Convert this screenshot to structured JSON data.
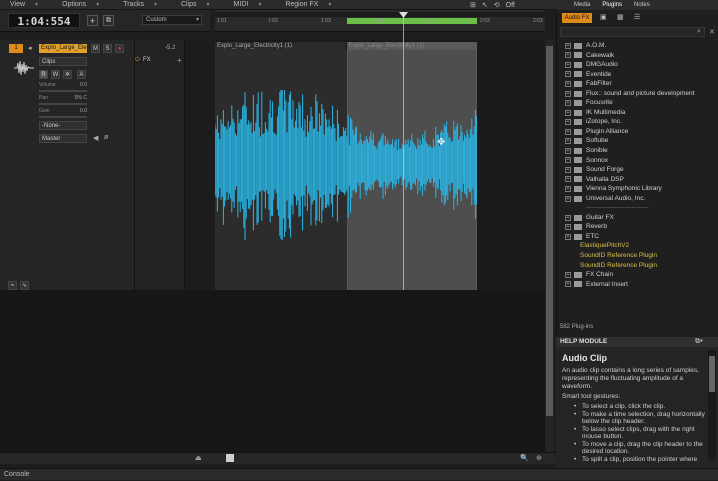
{
  "menu": {
    "items": [
      "View",
      "Options",
      "Tracks",
      "Clips",
      "MIDI",
      "Region FX"
    ],
    "off_label": "Off"
  },
  "control_bar": {
    "time": "1:04:554",
    "preset": "Custom"
  },
  "ruler": {
    "ticks": [
      "1:01",
      "1:02",
      "1:03",
      "1:04",
      "2:01",
      "2:02",
      "2:03"
    ]
  },
  "track": {
    "number": "1",
    "name": "Explo_Large_Ele",
    "mute": "M",
    "solo": "S",
    "record": "●",
    "gain_value": "-5.2",
    "fx_label": "FX",
    "clips_select": "Clips",
    "volume_label": "Volume",
    "volume_value": "0.0",
    "pan_label": "Pan",
    "pan_value": "0% C",
    "gain_label": "Gain",
    "gain2_value": "0.0",
    "input_select": "-None-",
    "output_select": "Master",
    "icon_r": "R",
    "icon_w": "W",
    "icon_a": "A"
  },
  "clips": {
    "left_name": "Explo_Large_Electricity1 (1)",
    "right_name": "Explo_Large_Electricity1 (1)"
  },
  "browser": {
    "tabs": [
      "Media",
      "Plugins",
      "Notes"
    ],
    "active_tab": "Audio FX",
    "plugins": [
      {
        "name": "A.O.M.",
        "type": "folder"
      },
      {
        "name": "Cakewalk",
        "type": "folder"
      },
      {
        "name": "DMGAudio",
        "type": "folder"
      },
      {
        "name": "Eventide",
        "type": "folder"
      },
      {
        "name": "FabFilter",
        "type": "folder"
      },
      {
        "name": "Flux:: sound and picture development",
        "type": "folder"
      },
      {
        "name": "Focusrite",
        "type": "folder"
      },
      {
        "name": "IK Multimedia",
        "type": "folder"
      },
      {
        "name": "iZotope, Inc.",
        "type": "folder"
      },
      {
        "name": "Plugin Alliance",
        "type": "folder"
      },
      {
        "name": "Softube",
        "type": "folder"
      },
      {
        "name": "Sonible",
        "type": "folder"
      },
      {
        "name": "Sonnox",
        "type": "folder"
      },
      {
        "name": "Sound Forge",
        "type": "folder"
      },
      {
        "name": "Valhalla DSP",
        "type": "folder"
      },
      {
        "name": "Vienna Symphonic Library",
        "type": "folder"
      },
      {
        "name": "Universal Audio, Inc.",
        "type": "folder"
      },
      {
        "name": "-----------------------------",
        "type": "separator"
      },
      {
        "name": "Guitar FX",
        "type": "folder"
      },
      {
        "name": "Reverb",
        "type": "folder"
      },
      {
        "name": "ETC",
        "type": "folder"
      },
      {
        "name": "ElastiquePitchV2",
        "type": "special"
      },
      {
        "name": "SoundID Reference Plugin",
        "type": "special"
      },
      {
        "name": "SoundID Reference Plugin",
        "type": "special"
      },
      {
        "name": "FX Chain",
        "type": "folder"
      },
      {
        "name": "External Insert",
        "type": "folder"
      }
    ],
    "plugin_count": "582 Plug-ins"
  },
  "help": {
    "module_title": "HELP MODULE",
    "title": "Audio Clip",
    "description": "An audio clip contains a long series of samples, representing the fluctuating amplitude of a waveform.",
    "subtitle": "Smart tool gestures:",
    "bullets": [
      "To select a clip, click the clip.",
      "To make a time selection, drag horizontally below the clip header.",
      "To lasso select clips, drag with the right mouse button.",
      "To move a clip, drag the clip header to the desired location.",
      "To split a clip, position the pointer where"
    ]
  },
  "console": {
    "label": "Console"
  },
  "colors": {
    "accent": "#e08a1a",
    "waveform": "#29b6e6",
    "loop": "#6cc04a"
  }
}
